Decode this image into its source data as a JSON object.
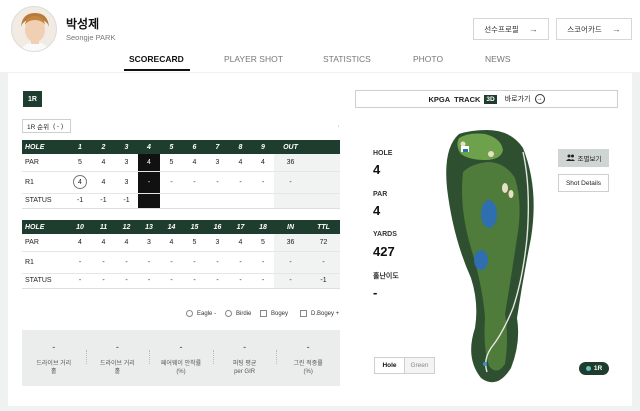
{
  "player": {
    "name": "박성제",
    "name_en": "Seongje PARK"
  },
  "header_buttons": [
    {
      "label": "선수프로필",
      "arrow": "→"
    },
    {
      "label": "스코어카드",
      "arrow": "→"
    }
  ],
  "tabs": [
    "SCORECARD",
    "PLAYER SHOT",
    "STATISTICS",
    "PHOTO",
    "NEWS"
  ],
  "active_tab": "SCORECARD",
  "round_badge": "1R",
  "round_select": {
    "label": "1R 순위",
    "value": "( - )"
  },
  "scorecard": {
    "front": {
      "header": [
        "HOLE",
        "1",
        "2",
        "3",
        "4",
        "5",
        "6",
        "7",
        "8",
        "9",
        "OUT",
        ""
      ],
      "par": [
        "PAR",
        "5",
        "4",
        "3",
        "4",
        "5",
        "4",
        "3",
        "4",
        "4",
        "36",
        ""
      ],
      "r1": [
        "R1",
        "4",
        "4",
        "3",
        "-",
        "-",
        "-",
        "-",
        "-",
        "-",
        "-",
        ""
      ],
      "status": [
        "STATUS",
        "-1",
        "-1",
        "-1",
        "",
        "",
        "",
        "",
        "",
        "",
        "",
        ""
      ]
    },
    "back": {
      "header": [
        "HOLE",
        "10",
        "11",
        "12",
        "13",
        "14",
        "15",
        "16",
        "17",
        "18",
        "IN",
        "TTL"
      ],
      "par": [
        "PAR",
        "4",
        "4",
        "4",
        "3",
        "4",
        "5",
        "3",
        "4",
        "5",
        "36",
        "72"
      ],
      "r1": [
        "R1",
        "-",
        "-",
        "-",
        "-",
        "-",
        "-",
        "-",
        "-",
        "-",
        "-",
        "-"
      ],
      "status": [
        "STATUS",
        "-",
        "-",
        "-",
        "-",
        "-",
        "-",
        "-",
        "-",
        "-",
        "-",
        "-1"
      ]
    }
  },
  "legend": [
    "Eagle -",
    "Birdie",
    "Bogey",
    "D.Bogey +"
  ],
  "stats": [
    {
      "value": "-",
      "label_1": "드라이브 거리",
      "label_2": "홀"
    },
    {
      "value": "-",
      "label_1": "드라이브 거리",
      "label_2": "홀"
    },
    {
      "value": "-",
      "label_1": "페어웨이 안착률",
      "label_2": "(%)"
    },
    {
      "value": "-",
      "label_1": "퍼팅 평균",
      "label_2": "per GIR"
    },
    {
      "value": "-",
      "label_1": "그린 적중률",
      "label_2": "(%)"
    }
  ],
  "kpga_track": {
    "brand": "KPGA",
    "track": "TRACK",
    "badge": "3D",
    "link": "바로가기"
  },
  "hole_info": [
    {
      "label": "HOLE",
      "value": "4"
    },
    {
      "label": "PAR",
      "value": "4"
    },
    {
      "label": "YARDS",
      "value": "427"
    },
    {
      "label": "홀난이도",
      "value": "-"
    }
  ],
  "group_button": "조별보기",
  "shot_details_button": "Shot Details",
  "view_toggle": [
    "Hole",
    "Green"
  ],
  "round_pill": "1R",
  "colors": {
    "dark_green": "#1f3d2f",
    "fairway": "#4e7a3a",
    "rough": "#2d4f2c",
    "water": "#2f6fb0"
  }
}
